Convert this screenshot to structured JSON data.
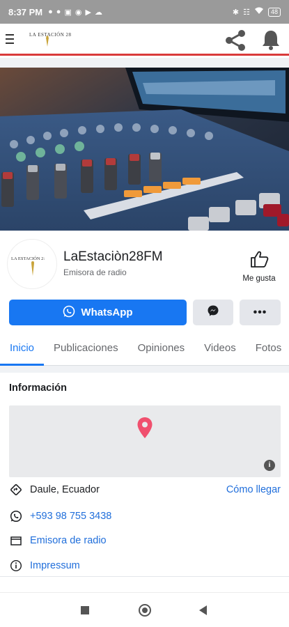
{
  "status_bar": {
    "time": "8:37 PM",
    "battery": "48",
    "left_icons": [
      "person-icon",
      "person-icon",
      "square-icon",
      "vpn-key-icon",
      "play-icon",
      "cloud-icon"
    ],
    "right_icons": [
      "bluetooth-icon",
      "vibrate-icon",
      "wifi-icon",
      "battery-icon"
    ]
  },
  "app_bar": {
    "logo_text": "LA ESTACIÓN 28",
    "icons": [
      "menu-icon",
      "share-icon",
      "bell-icon"
    ],
    "accent_color": "#d93a3a"
  },
  "profile": {
    "avatar_text": "LA ESTACIÓN 2:",
    "name": "LaEstaciòn28FM",
    "category": "Emisora de radio",
    "like_label": "Me gusta"
  },
  "actions": {
    "whatsapp_label": "WhatsApp",
    "primary_color": "#1877f2"
  },
  "tabs": [
    {
      "label": "Inicio",
      "active": true
    },
    {
      "label": "Publicaciones",
      "active": false
    },
    {
      "label": "Opiniones",
      "active": false
    },
    {
      "label": "Videos",
      "active": false
    },
    {
      "label": "Fotos",
      "active": false
    }
  ],
  "info": {
    "title": "Información",
    "location": "Daule, Ecuador",
    "directions_label": "Cómo llegar",
    "phone": "+593 98 755 3438",
    "category_link": "Emisora de radio",
    "impressum": "Impressum"
  }
}
